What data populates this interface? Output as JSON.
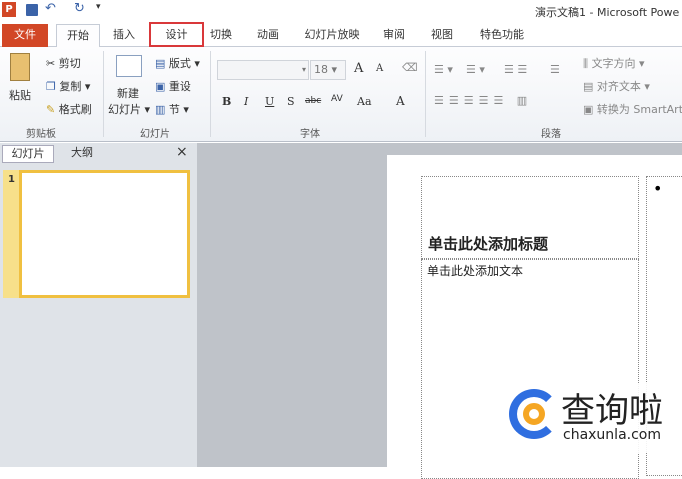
{
  "window": {
    "title": "演示文稿1 - Microsoft Powe"
  },
  "tabs": [
    "文件",
    "开始",
    "插入",
    "设计",
    "切换",
    "动画",
    "幻灯片放映",
    "审阅",
    "视图",
    "特色功能"
  ],
  "ribbon": {
    "clipboard": {
      "paste": "粘贴",
      "cut": "剪切",
      "copy": "复制",
      "format_painter": "格式刷",
      "label": "剪贴板"
    },
    "slides": {
      "new_slide": "新建",
      "new_slide2": "幻灯片",
      "layout": "版式",
      "reset": "重设",
      "section": "节",
      "label": "幻灯片"
    },
    "font": {
      "size": "18",
      "label": "字体",
      "bold": "B",
      "italic": "I",
      "underline": "U",
      "shadow": "S",
      "strike": "abc",
      "spacing": "AV",
      "case": "Aa",
      "color": "A",
      "grow": "A",
      "shrink": "A"
    },
    "paragraph": {
      "text_direction": "文字方向",
      "align_text": "对齐文本",
      "smartart": "转换为 SmartArt",
      "label": "段落"
    }
  },
  "pane": {
    "tab_slides": "幻灯片",
    "tab_outline": "大纲",
    "close": "×",
    "slide_number": "1"
  },
  "slide": {
    "title_placeholder": "单击此处添加标题",
    "body_placeholder": "单击此处添加文本",
    "bullet": "•"
  },
  "watermark": {
    "name": "查询啦",
    "url": "chaxunla.com"
  },
  "colors": {
    "file_tab": "#d24726",
    "highlight": "#d9383a",
    "thumb_border": "#f0c040"
  }
}
